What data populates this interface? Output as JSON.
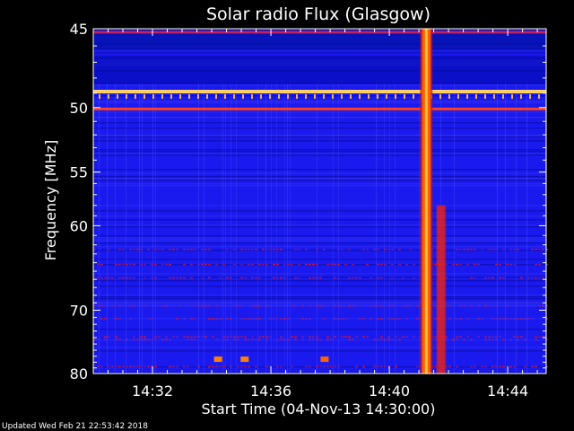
{
  "chart_data": {
    "type": "heatmap",
    "title": "Solar radio Flux (Glasgow)",
    "xlabel": "Start Time (04-Nov-13 14:30:00)",
    "ylabel": "Frequency [MHz]",
    "x_unit": "minutes after 14:30:00",
    "xlim": [
      0,
      15.3
    ],
    "ylim": [
      45,
      80
    ],
    "y_scale": "reciprocal",
    "x_ticks": [
      {
        "value": 2,
        "label": "14:32"
      },
      {
        "value": 6,
        "label": "14:36"
      },
      {
        "value": 10,
        "label": "14:40"
      },
      {
        "value": 14,
        "label": "14:44"
      }
    ],
    "y_ticks": [
      {
        "value": 45,
        "label": "45"
      },
      {
        "value": 50,
        "label": "50"
      },
      {
        "value": 55,
        "label": "55"
      },
      {
        "value": 60,
        "label": "60"
      },
      {
        "value": 70,
        "label": "70"
      },
      {
        "value": 80,
        "label": "80"
      }
    ],
    "background_color": "#1a1aee",
    "colormap": [
      "#000050",
      "#0000c8",
      "#2a2aff",
      "#c00030",
      "#ff3000",
      "#ffa000",
      "#ffff80"
    ],
    "features": [
      {
        "kind": "horizontal_band",
        "freq": 48.9,
        "intensity": "high",
        "color": "#ffd060"
      },
      {
        "kind": "horizontal_band",
        "freq": 50.1,
        "intensity": "medium",
        "color": "#ff4020"
      },
      {
        "kind": "horizontal_band",
        "freq": 45.2,
        "intensity": "medium",
        "color": "#c02060"
      },
      {
        "kind": "vertical_burst",
        "time_start": 11.1,
        "time_end": 11.4,
        "freq_range": [
          45,
          80
        ],
        "color": "#ff6000"
      },
      {
        "kind": "burst_tail",
        "time_start": 11.6,
        "time_end": 11.9,
        "freq_range": [
          58,
          80
        ],
        "color": "#ff2000"
      },
      {
        "kind": "spot",
        "time": 4.2,
        "freq": 77.5,
        "color": "#ff8000"
      },
      {
        "kind": "spot",
        "time": 5.1,
        "freq": 77.5,
        "color": "#ff8000"
      },
      {
        "kind": "spot",
        "time": 7.8,
        "freq": 77.5,
        "color": "#ff6000"
      }
    ]
  },
  "footer": {
    "updated": "Updated Wed Feb 21 22:53:42 2018"
  }
}
